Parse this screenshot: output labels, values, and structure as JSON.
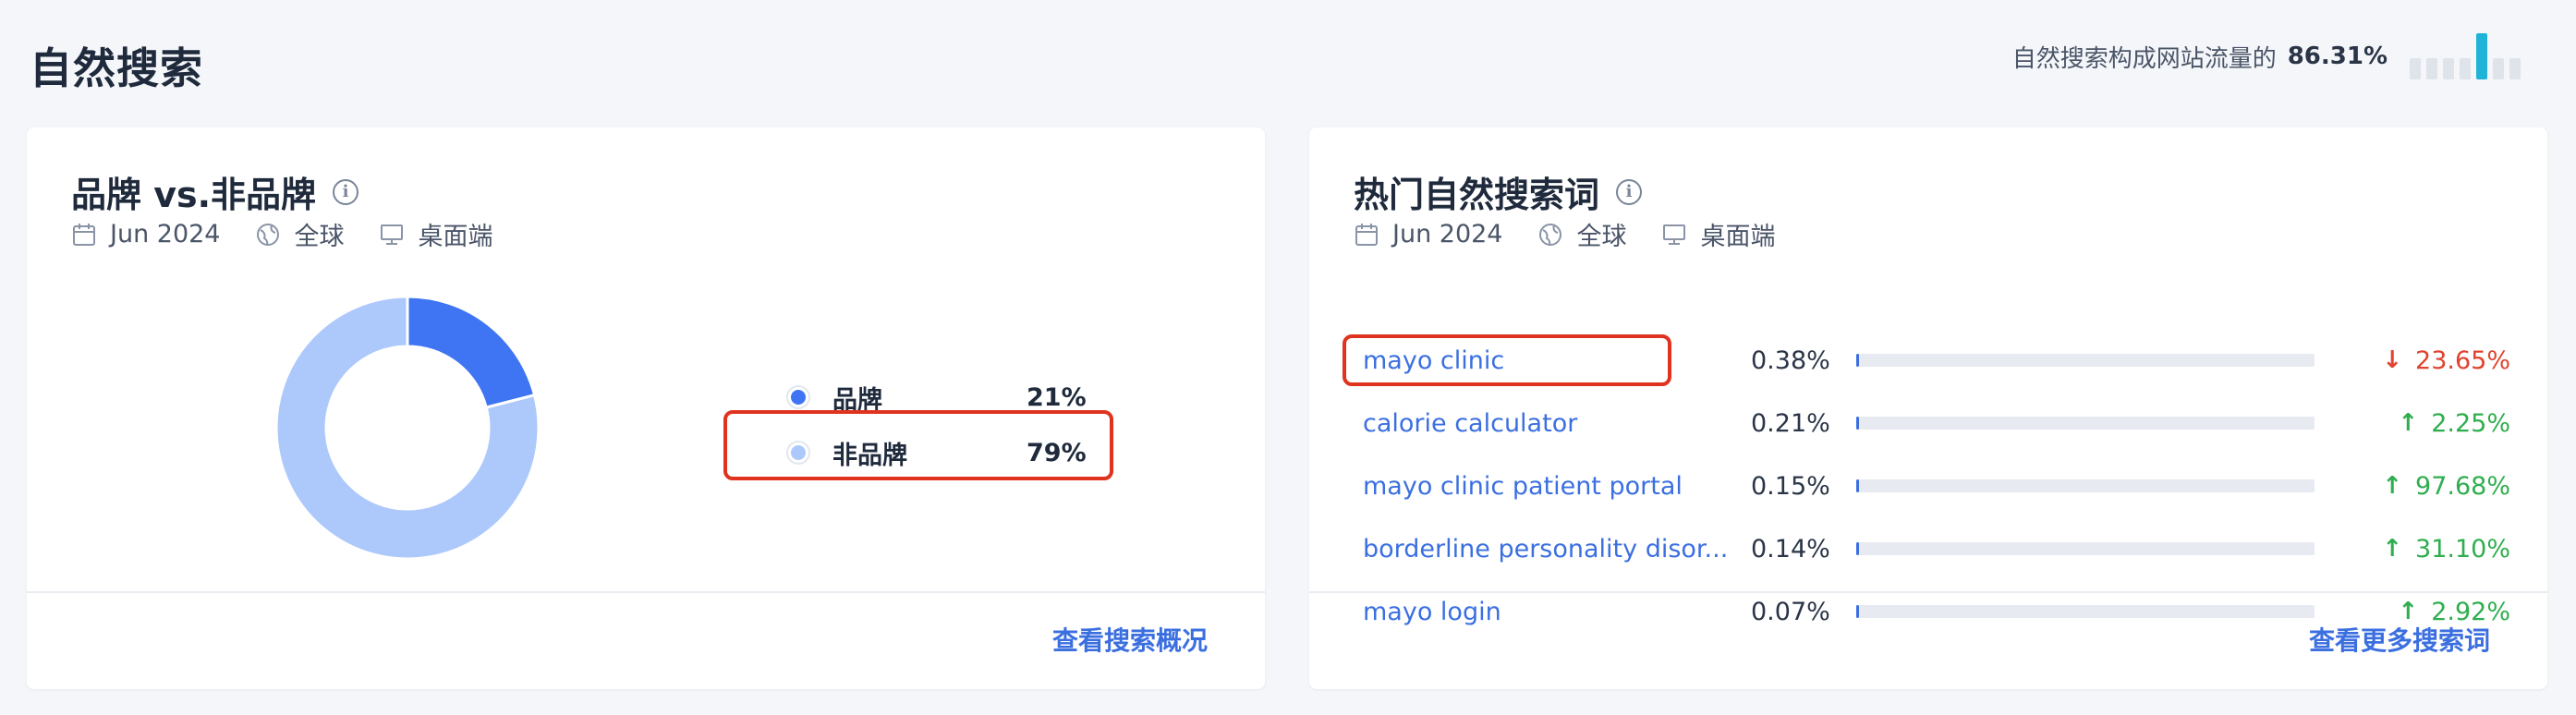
{
  "page": {
    "title": "自然搜索",
    "share_text": "自然搜索构成网站流量的",
    "share_value": "86.31%",
    "mini_bars": [
      0.45,
      0.45,
      0.45,
      0.45,
      1.0,
      0.45,
      0.45
    ]
  },
  "brand_card": {
    "title": "品牌 vs.非品牌",
    "info_icon": "info-icon",
    "meta": {
      "date": "Jun 2024",
      "region": "全球",
      "device": "桌面端"
    },
    "legend": [
      {
        "label": "品牌",
        "value": "21%",
        "color": "#3f74f3"
      },
      {
        "label": "非品牌",
        "value": "79%",
        "color": "#adc8fb"
      }
    ],
    "chart_data": {
      "type": "pie",
      "categories": [
        "品牌",
        "非品牌"
      ],
      "values": [
        21,
        79
      ],
      "colors": [
        "#3f74f3",
        "#adc8fb"
      ]
    },
    "footer_link": "查看搜索概况"
  },
  "keywords_card": {
    "title": "热门自然搜索词",
    "info_icon": "info-icon",
    "meta": {
      "date": "Jun 2024",
      "region": "全球",
      "device": "桌面端"
    },
    "rows": [
      {
        "keyword": "mayo clinic",
        "share": "0.38%",
        "share_value": 0.38,
        "change": "23.65%",
        "direction": "down"
      },
      {
        "keyword": "calorie calculator",
        "share": "0.21%",
        "share_value": 0.21,
        "change": "2.25%",
        "direction": "up"
      },
      {
        "keyword": "mayo clinic patient portal",
        "share": "0.15%",
        "share_value": 0.15,
        "change": "97.68%",
        "direction": "up"
      },
      {
        "keyword": "borderline personality disor...",
        "share": "0.14%",
        "share_value": 0.14,
        "change": "31.10%",
        "direction": "up"
      },
      {
        "keyword": "mayo login",
        "share": "0.07%",
        "share_value": 0.07,
        "change": "2.92%",
        "direction": "up"
      }
    ],
    "footer_link": "查看更多搜索词"
  },
  "colors": {
    "accent": "#3b6fe0",
    "down": "#e0432f",
    "up": "#2fae4e",
    "highlight": "#e0331f"
  }
}
